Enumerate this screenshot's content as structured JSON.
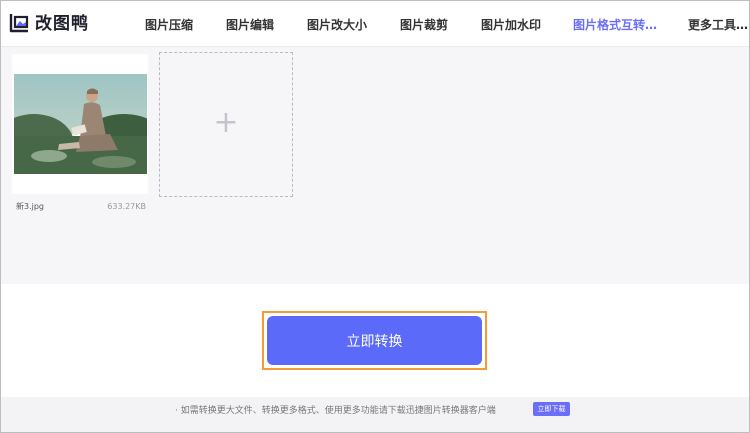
{
  "header": {
    "brand": "改图鸭",
    "logo_icon": "image-frame-icon",
    "nav": [
      {
        "label": "图片压缩",
        "active": false
      },
      {
        "label": "图片编辑",
        "active": false
      },
      {
        "label": "图片改大小",
        "active": false
      },
      {
        "label": "图片裁剪",
        "active": false
      },
      {
        "label": "图片加水印",
        "active": false
      },
      {
        "label": "图片格式互转…",
        "active": true
      },
      {
        "label": "更多工具…",
        "active": false
      }
    ]
  },
  "upload": {
    "file": {
      "name": "新3.jpg",
      "size": "633.27KB"
    },
    "add_symbol": "+"
  },
  "convert_button": "立即转换",
  "footer": {
    "notice": "· 如需转换更大文件、转换更多格式、使用更多功能请下载迅捷图片转换器客户端",
    "download_button": "立即下载"
  },
  "colors": {
    "accent": "#5b6af8",
    "nav_active": "#6b6ef9",
    "highlight_outline": "#f39c38",
    "area_background": "#f6f6f9"
  }
}
